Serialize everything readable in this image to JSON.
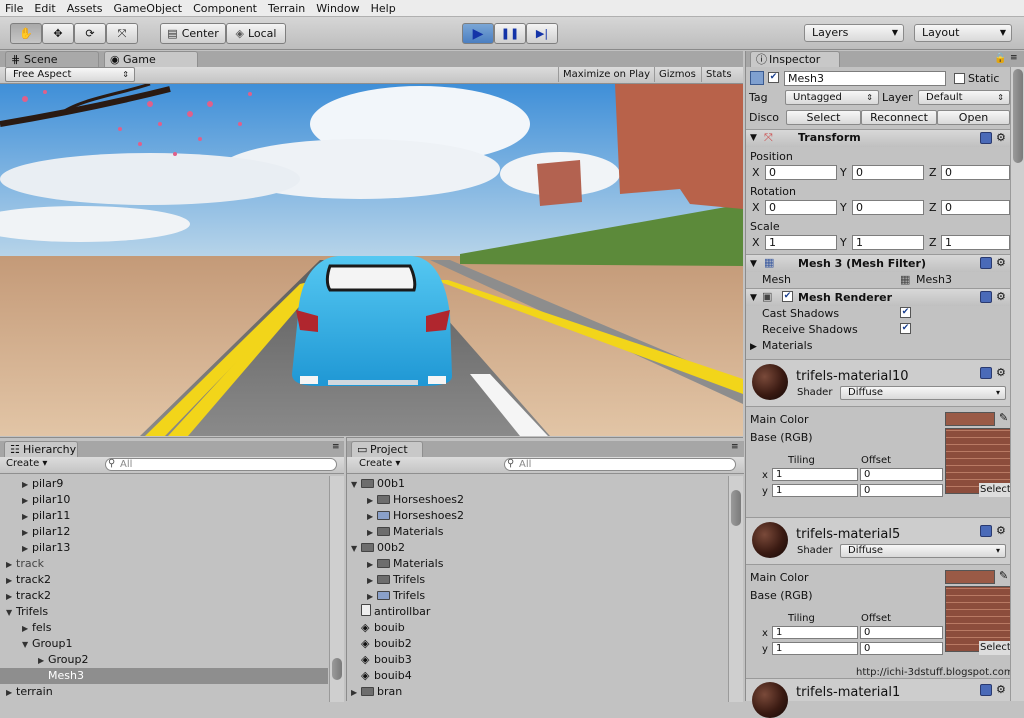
{
  "menu": [
    "File",
    "Edit",
    "Assets",
    "GameObject",
    "Component",
    "Terrain",
    "Window",
    "Help"
  ],
  "toolbar": {
    "center_label": "Center",
    "local_label": "Local",
    "layers_label": "Layers",
    "layout_label": "Layout"
  },
  "game_view": {
    "scene_tab": "Scene",
    "game_tab": "Game",
    "aspect": "Free Aspect",
    "maximize": "Maximize on Play",
    "gizmos": "Gizmos",
    "stats": "Stats"
  },
  "hierarchy": {
    "title": "Hierarchy",
    "create": "Create",
    "search_placeholder": "All",
    "items": [
      {
        "label": "pilar9"
      },
      {
        "label": "pilar10"
      },
      {
        "label": "pilar11"
      },
      {
        "label": "pilar12"
      },
      {
        "label": "pilar13"
      },
      {
        "label": "track"
      },
      {
        "label": "track2"
      },
      {
        "label": "track2"
      },
      {
        "label": "Trifels"
      },
      {
        "label": "fels"
      },
      {
        "label": "Group1"
      },
      {
        "label": "Group2"
      },
      {
        "label": "Mesh3"
      },
      {
        "label": "terrain"
      }
    ]
  },
  "project": {
    "title": "Project",
    "create": "Create",
    "search_placeholder": "All",
    "items": [
      {
        "label": "00b1"
      },
      {
        "label": "Horseshoes2"
      },
      {
        "label": "Horseshoes2"
      },
      {
        "label": "Materials"
      },
      {
        "label": "00b2"
      },
      {
        "label": "Materials"
      },
      {
        "label": "Trifels"
      },
      {
        "label": "Trifels"
      },
      {
        "label": "antirollbar"
      },
      {
        "label": "bouib"
      },
      {
        "label": "bouib2"
      },
      {
        "label": "bouib3"
      },
      {
        "label": "bouib4"
      },
      {
        "label": "bran"
      }
    ]
  },
  "inspector": {
    "title": "Inspector",
    "object_name": "Mesh3",
    "static_label": "Static",
    "tag_label": "Tag",
    "tag_value": "Untagged",
    "layer_label": "Layer",
    "layer_value": "Default",
    "prefab_label": "Disco",
    "prefab_select": "Select",
    "prefab_reconnect": "Reconnect",
    "prefab_open": "Open",
    "transform": {
      "title": "Transform",
      "position_label": "Position",
      "px": "0",
      "py": "0",
      "pz": "0",
      "rotation_label": "Rotation",
      "rx": "0",
      "ry": "0",
      "rz": "0",
      "scale_label": "Scale",
      "sx": "1",
      "sy": "1",
      "sz": "1",
      "x": "X",
      "y": "Y",
      "z": "Z"
    },
    "mesh_filter": {
      "title": "Mesh 3 (Mesh Filter)",
      "mesh_label": "Mesh",
      "mesh_value": "Mesh3"
    },
    "mesh_renderer": {
      "title": "Mesh Renderer",
      "cast_label": "Cast Shadows",
      "receive_label": "Receive Shadows",
      "materials_label": "Materials"
    },
    "materials": [
      {
        "name": "trifels-material10",
        "shader_label": "Shader",
        "shader": "Diffuse",
        "main_color": "Main Color",
        "base": "Base (RGB)",
        "tiling": "Tiling",
        "offset": "Offset",
        "tx": "1",
        "ty": "1",
        "ox": "0",
        "oy": "0",
        "select": "Select"
      },
      {
        "name": "trifels-material5",
        "shader_label": "Shader",
        "shader": "Diffuse",
        "main_color": "Main Color",
        "base": "Base (RGB)",
        "tiling": "Tiling",
        "offset": "Offset",
        "tx": "1",
        "ty": "1",
        "ox": "0",
        "oy": "0",
        "select": "Select"
      },
      {
        "name": "trifels-material1"
      }
    ],
    "axis_x": "x",
    "axis_y": "y"
  },
  "watermark": "http://ichi-3dstuff.blogspot.com"
}
